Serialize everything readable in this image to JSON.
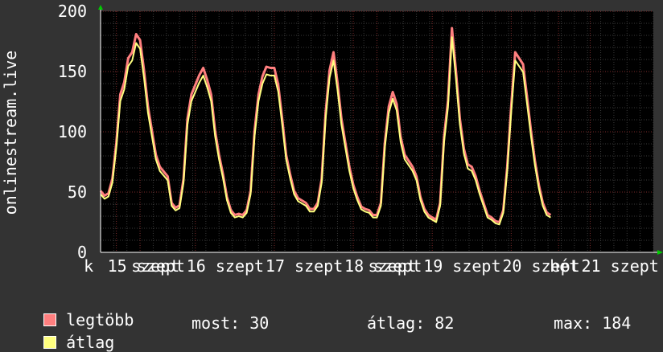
{
  "chart_data": {
    "type": "area",
    "ylabel": "onlinestream.live",
    "ylim": [
      0,
      200
    ],
    "yticks": [
      0,
      50,
      100,
      150,
      200
    ],
    "xlim": [
      0,
      7
    ],
    "xticks": [
      {
        "pos": -0.1,
        "label": "k"
      },
      {
        "pos": 0.2,
        "label": "15 szept"
      },
      {
        "pos": 0.5,
        "label": "szept"
      },
      {
        "pos": 1.2,
        "label": "16 szept"
      },
      {
        "pos": 2.2,
        "label": "17 szept"
      },
      {
        "pos": 3.2,
        "label": "18 szept"
      },
      {
        "pos": 3.5,
        "label": "szept"
      },
      {
        "pos": 4.2,
        "label": "19 szept"
      },
      {
        "pos": 5.2,
        "label": "20 szept"
      },
      {
        "pos": 5.8,
        "label": "hét"
      },
      {
        "pos": 6.2,
        "label": "21 szept"
      }
    ],
    "grid": true,
    "series": [
      {
        "name": "legtöbb",
        "color": "#ff7f7f",
        "style": "fill"
      },
      {
        "name": "átlag",
        "color": "#ffff7f",
        "style": "line"
      }
    ],
    "x": [
      0.0,
      0.05,
      0.1,
      0.15,
      0.2,
      0.25,
      0.3,
      0.35,
      0.4,
      0.45,
      0.5,
      0.55,
      0.6,
      0.65,
      0.7,
      0.75,
      0.8,
      0.85,
      0.9,
      0.95,
      1.0,
      1.05,
      1.1,
      1.15,
      1.2,
      1.25,
      1.3,
      1.35,
      1.4,
      1.45,
      1.5,
      1.55,
      1.6,
      1.65,
      1.7,
      1.75,
      1.8,
      1.85,
      1.9,
      1.95,
      2.0,
      2.05,
      2.1,
      2.15,
      2.2,
      2.25,
      2.3,
      2.35,
      2.4,
      2.45,
      2.5,
      2.55,
      2.6,
      2.65,
      2.7,
      2.75,
      2.8,
      2.85,
      2.9,
      2.95,
      3.0,
      3.05,
      3.1,
      3.15,
      3.2,
      3.25,
      3.3,
      3.35,
      3.4,
      3.45,
      3.5,
      3.55,
      3.6,
      3.65,
      3.7,
      3.75,
      3.8,
      3.85,
      3.9,
      3.95,
      4.0,
      4.05,
      4.1,
      4.15,
      4.2,
      4.25,
      4.3,
      4.35,
      4.4,
      4.45,
      4.5,
      4.55,
      4.6,
      4.65,
      4.7,
      4.75,
      4.8,
      4.85,
      4.9,
      4.95,
      5.0,
      5.05,
      5.1,
      5.15,
      5.2,
      5.25,
      5.3,
      5.35,
      5.4,
      5.45,
      5.5,
      5.55,
      5.6,
      5.65,
      5.7,
      5.75,
      5.8,
      5.85,
      5.9,
      5.95,
      6.0,
      6.05,
      6.1,
      6.15,
      6.2,
      6.25,
      6.3,
      6.35,
      6.4,
      6.45,
      6.5,
      6.55,
      6.6,
      6.65,
      6.7,
      6.75,
      6.8,
      6.85,
      6.9,
      6.95,
      7.0
    ],
    "max_values": [
      50,
      46,
      48,
      60,
      90,
      130,
      140,
      160,
      165,
      180,
      175,
      150,
      120,
      100,
      80,
      70,
      66,
      62,
      40,
      36,
      38,
      60,
      110,
      130,
      138,
      146,
      152,
      142,
      130,
      100,
      80,
      64,
      45,
      34,
      30,
      31,
      30,
      34,
      50,
      100,
      130,
      145,
      153,
      152,
      152,
      138,
      110,
      80,
      64,
      50,
      44,
      42,
      40,
      35,
      35,
      40,
      60,
      115,
      150,
      165,
      140,
      110,
      90,
      70,
      55,
      45,
      37,
      35,
      34,
      30,
      30,
      40,
      90,
      120,
      132,
      122,
      95,
      80,
      75,
      70,
      62,
      45,
      35,
      30,
      28,
      26,
      40,
      95,
      125,
      185,
      150,
      110,
      85,
      72,
      70,
      62,
      50,
      40,
      30,
      28,
      25,
      24,
      34,
      70,
      120,
      165,
      160,
      155,
      128,
      100,
      75,
      55,
      40,
      32,
      30
    ]
  },
  "legend": {
    "max_label": "legtöbb",
    "avg_label": "átlag"
  },
  "stats": {
    "now": "most: 30",
    "avg": "átlag: 82",
    "max": "max: 184"
  }
}
